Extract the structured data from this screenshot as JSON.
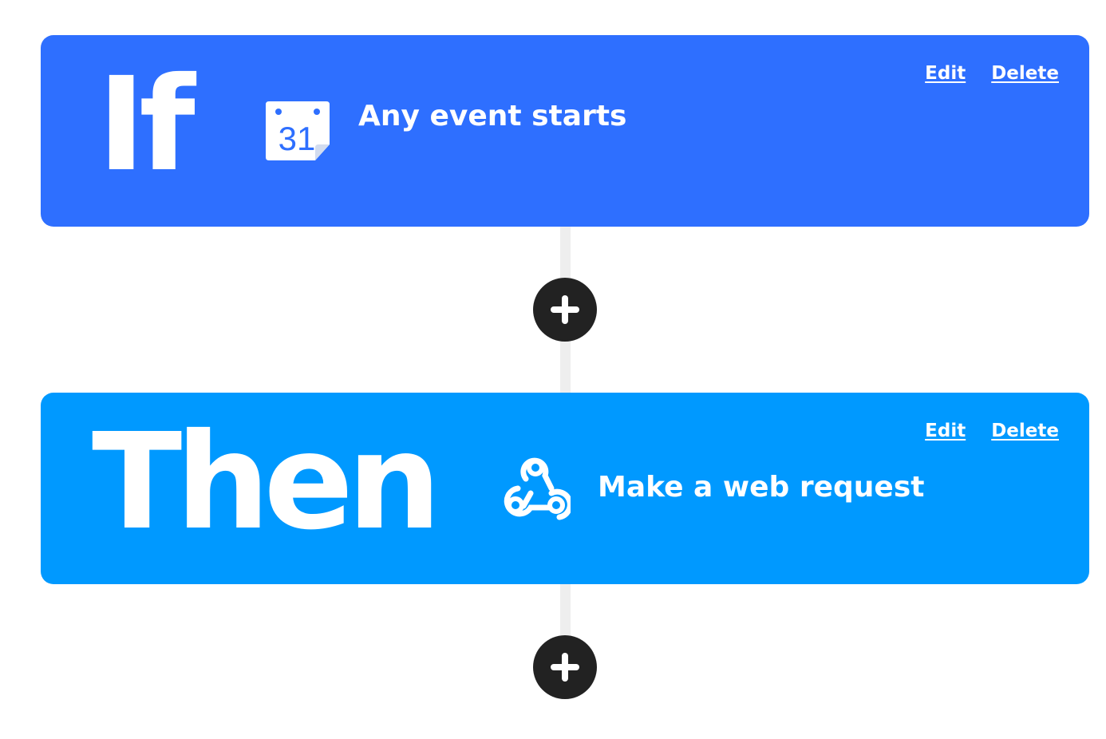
{
  "trigger": {
    "keyword": "If",
    "service_icon": "google-calendar-icon",
    "calendar_day": "31",
    "label": "Any event starts",
    "edit_label": "Edit",
    "delete_label": "Delete",
    "color": "#2e6fff"
  },
  "action": {
    "keyword": "Then",
    "service_icon": "webhooks-icon",
    "label": "Make a web request",
    "edit_label": "Edit",
    "delete_label": "Delete",
    "color": "#0099ff"
  },
  "add_buttons": [
    {
      "icon": "plus-icon"
    },
    {
      "icon": "plus-icon"
    }
  ],
  "colors": {
    "connector": "#eeeeee",
    "add_button": "#222222",
    "text": "#ffffff"
  }
}
